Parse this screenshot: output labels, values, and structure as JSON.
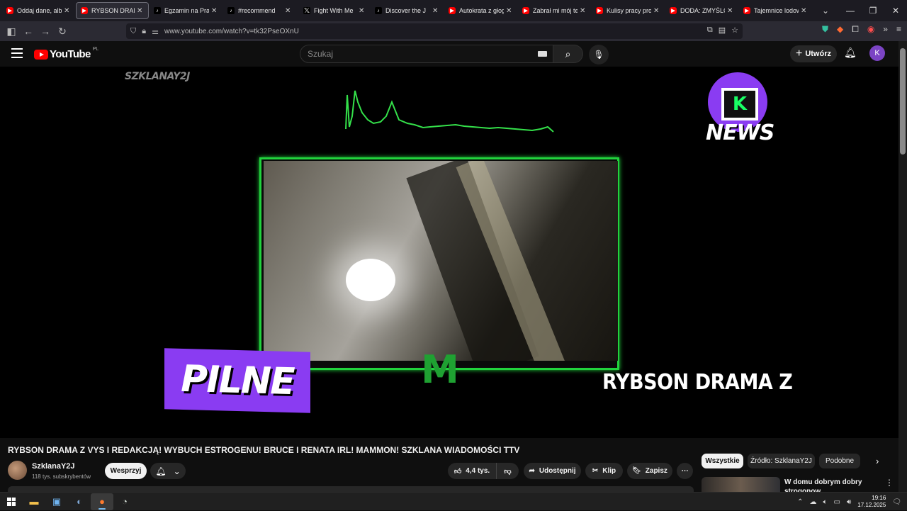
{
  "browser": {
    "tabs": [
      {
        "label": "Oddaj dane, albo zg",
        "icon": "youtube-icon",
        "active": false
      },
      {
        "label": "RYBSON DRAMA Z",
        "icon": "youtube-icon",
        "active": true
      },
      {
        "label": "Egzamin na Prawo j",
        "icon": "tiktok-icon",
        "active": false
      },
      {
        "label": "#recommend",
        "icon": "tiktok-icon",
        "active": false
      },
      {
        "label": "Fight With Me",
        "icon": "x-icon",
        "active": false
      },
      {
        "label": "Discover the J",
        "icon": "tiktok-icon",
        "active": false
      },
      {
        "label": "Autokrata z głogo",
        "icon": "youtube-icon",
        "active": false
      },
      {
        "label": "Zabrał mi mój tele",
        "icon": "youtube-icon",
        "active": false
      },
      {
        "label": "Kulisy pracy prosty",
        "icon": "youtube-icon",
        "active": false
      },
      {
        "label": "DODA: ZMYŚLONE",
        "icon": "youtube-icon",
        "active": false
      },
      {
        "label": "Tajemnice lodowca",
        "icon": "youtube-icon",
        "active": false
      }
    ],
    "url": "www.youtube.com/watch?v=tk32PseOXnU"
  },
  "youtube": {
    "logo_text": "YouTube",
    "region": "PL",
    "search_placeholder": "Szukaj",
    "create_label": "Utwórz",
    "avatar_letter": "K"
  },
  "video": {
    "watermark": "SZKLANAY2J",
    "news_logo_text": "NEWS",
    "news_logo_letter": "K",
    "center_letter": "M",
    "badge_text": "PILNE",
    "overlay_text": "RYBSON DRAMA Z",
    "title": "RYBSON DRAMA Z VYS I REDAKCJĄ! WYBUCH ESTROGENU! BRUCE I RENATA IRL! MAMMON! SZKLANA WIADOMOŚCI TTV"
  },
  "channel": {
    "name": "SzklanaY2J",
    "subscribers": "118 tys. subskrybentów",
    "support_label": "Wesprzyj"
  },
  "actions": {
    "likes": "4,4 tys.",
    "share": "Udostępnij",
    "clip": "Klip",
    "save": "Zapisz"
  },
  "chips": [
    "Wszystkie",
    "Źródło: SzklanaY2J",
    "Podobne"
  ],
  "recommendation": {
    "title": "W domu dobrym dobry strogonow"
  },
  "taskbar": {
    "time": "19:16",
    "date": "17.12.2025"
  }
}
